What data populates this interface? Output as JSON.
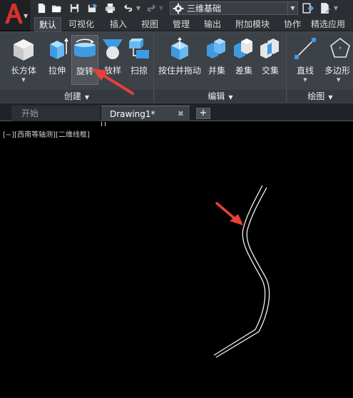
{
  "title_bar": {
    "workspace_name": "三维基础"
  },
  "ribbon_tabs": [
    "默认",
    "可视化",
    "插入",
    "视图",
    "管理",
    "输出",
    "附加模块",
    "协作",
    "精选应用"
  ],
  "ribbon": {
    "create_buttons": [
      {
        "label": "长方体",
        "icon": "box-icon"
      },
      {
        "label": "拉伸",
        "icon": "extrude-icon"
      },
      {
        "label": "旋转",
        "icon": "revolve-icon"
      },
      {
        "label": "放样",
        "icon": "loft-icon"
      },
      {
        "label": "扫掠",
        "icon": "sweep-icon"
      }
    ],
    "edit_buttons": [
      {
        "label": "按住并拖动",
        "icon": "presspull-icon"
      },
      {
        "label": "并集",
        "icon": "union-icon"
      },
      {
        "label": "差集",
        "icon": "subtract-icon"
      },
      {
        "label": "交集",
        "icon": "intersect-icon"
      }
    ],
    "draw_buttons": [
      {
        "label": "直线",
        "icon": "line-icon"
      },
      {
        "label": "多边形",
        "icon": "polygon-icon"
      }
    ],
    "panels": {
      "create": "创建",
      "edit": "编辑",
      "draw": "绘图"
    }
  },
  "file_tabs": {
    "start": "开始",
    "drawing": "Drawing1*",
    "close_glyph": "✖",
    "add_glyph": "+"
  },
  "canvas": {
    "viewport_label": "[−][西南等轴测][二维线框]"
  },
  "colors": {
    "annotation_arrow": "#e8403a",
    "canvas_bg": "#000000",
    "ribbon_bg": "#3d4148"
  }
}
